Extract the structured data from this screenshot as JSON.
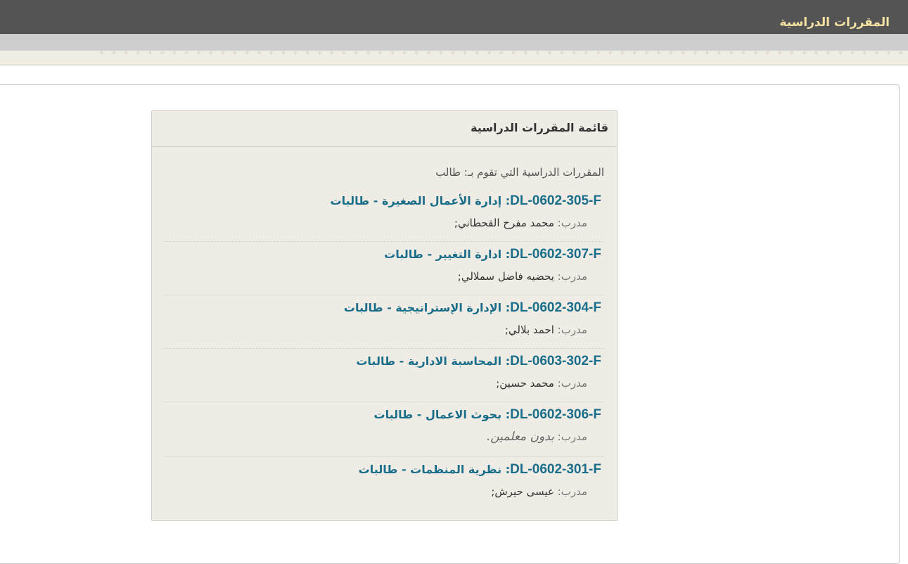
{
  "header": {
    "title": "المقررات الدراسية"
  },
  "block": {
    "title": "قائمة المقررات الدراسية",
    "role_line": "المقررات الدراسية التي تقوم بـ: طالب"
  },
  "teacher_label": "مدرب:",
  "courses": [
    {
      "code": "DL-0602-305-F",
      "name": "إدارة الأعمال الصغيرة - طالبات",
      "teacher": "محمد مفرح القحطاني;"
    },
    {
      "code": "DL-0602-307-F",
      "name": "ادارة التغيير - طالبات",
      "teacher": "يحضيه فاضل سملالي;"
    },
    {
      "code": "DL-0602-304-F",
      "name": "الإدارة الإستراتيجية - طالبات",
      "teacher": "احمد بلالي;"
    },
    {
      "code": "DL-0603-302-F",
      "name": "المحاسبة الادارية - طالبات",
      "teacher": "محمد حسين;"
    },
    {
      "code": "DL-0602-306-F",
      "name": "بحوث الاعمال - طالبات",
      "teacher": "بدون معلمين."
    },
    {
      "code": "DL-0602-301-F",
      "name": "نظرية المنظمات - طالبات",
      "teacher": "عيسى حيرش;"
    }
  ]
}
